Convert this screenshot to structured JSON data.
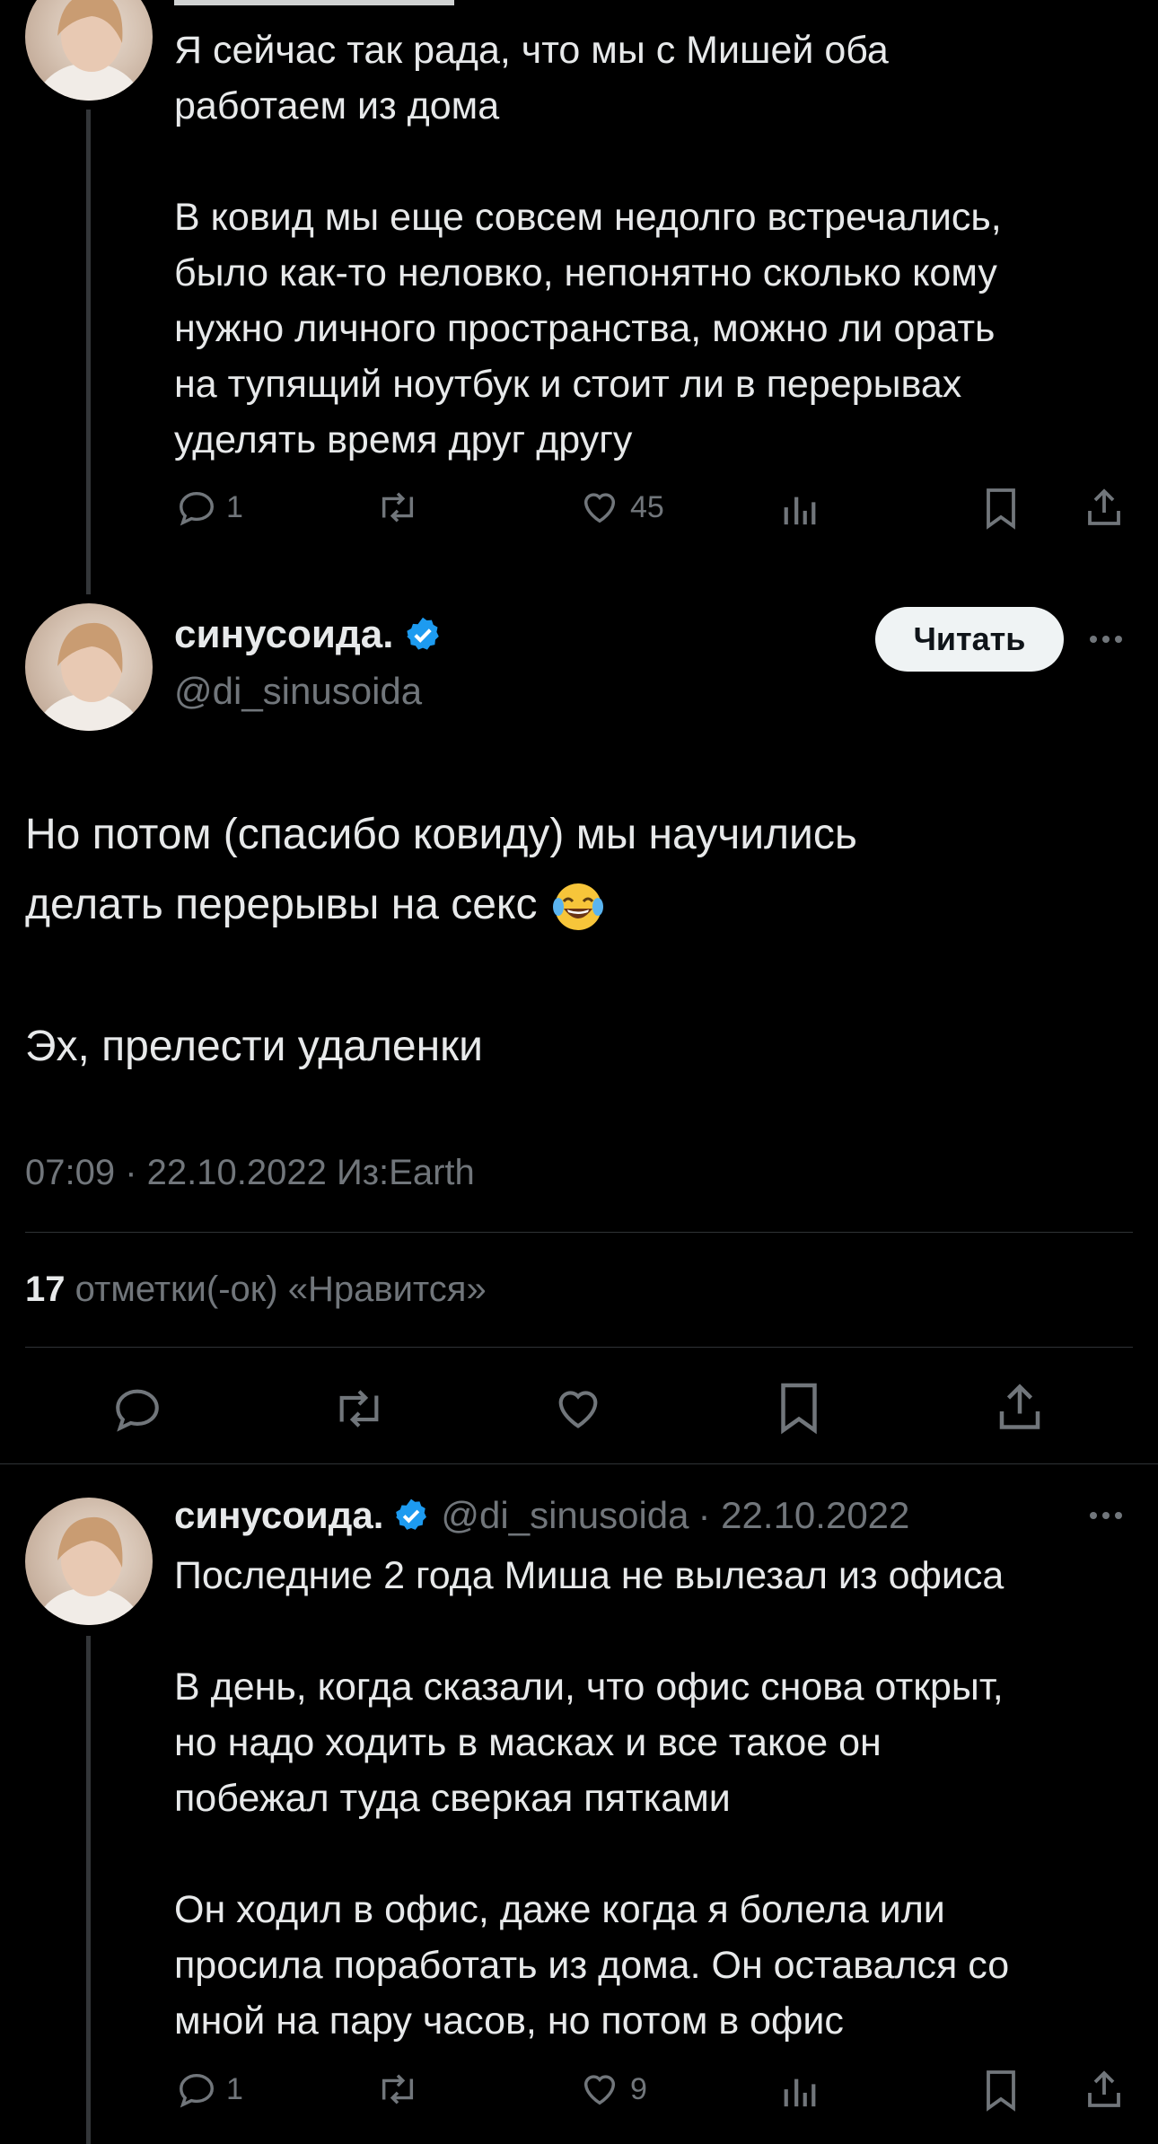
{
  "colors": {
    "background": "#000000",
    "text": "#e7e9ea",
    "muted": "#71767b",
    "verified": "#1d9bf0",
    "divider": "#2f3336"
  },
  "tweet_top": {
    "text": "Я сейчас так рада, что мы с Мишей оба\nработаем из дома\n\nВ ковид мы еще совсем недолго встречались,\nбыло как-то неловко, непонятно сколько кому\nнужно личного пространства, можно ли орать\nна тупящий ноутбук и стоит ли в перерывах\nуделять время друг другу",
    "replies": "1",
    "likes": "45"
  },
  "main_tweet": {
    "display_name": "синусоида.",
    "handle": "@di_sinusoida",
    "follow_label": "Читать",
    "text_line1": "Но потом (спасибо ковиду) мы научились",
    "text_line2": "делать перерывы на секс",
    "emoji": "😂",
    "text_line3": "Эх, прелести удаленки",
    "meta": "07:09 · 22.10.2022 Из:Earth",
    "likes_count": "17",
    "likes_label": "отметки(-ок) «Нравится»"
  },
  "reply_tweet": {
    "display_name": "синусоида.",
    "handle": "@di_sinusoida",
    "date": "· 22.10.2022",
    "text": "Последние 2 года Миша не вылезал из офиса\n\nВ день, когда сказали, что офис снова открыт,\nно надо ходить в масках и все такое он\nпобежал туда сверкая пятками\n\nОн ходил в офис, даже когда я болела или\nпросила поработать из дома. Он оставался со\nмной на пару часов, но потом в офис",
    "replies": "1",
    "likes": "9"
  },
  "icons": [
    "reply-icon",
    "retweet-icon",
    "like-icon",
    "views-icon",
    "bookmark-icon",
    "share-icon",
    "verified-icon",
    "more-icon"
  ]
}
